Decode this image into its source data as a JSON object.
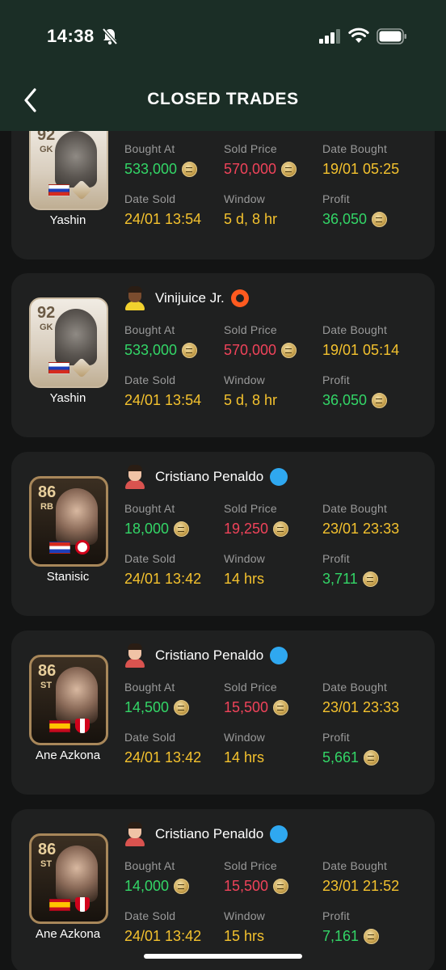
{
  "status_bar": {
    "time": "14:38"
  },
  "header": {
    "title": "CLOSED TRADES"
  },
  "labels": {
    "bought_at": "Bought At",
    "sold_price": "Sold Price",
    "date_bought": "Date Bought",
    "date_sold": "Date Sold",
    "window": "Window",
    "profit": "Profit"
  },
  "trades": [
    {
      "player": {
        "name": "Yashin",
        "rating": "92",
        "position": "GK",
        "flag": "russia"
      },
      "seller": {
        "name": "",
        "platform": ""
      },
      "bought_at": "533,000",
      "sold_price": "570,000",
      "date_bought": "19/01 05:25",
      "date_sold": "24/01 13:54",
      "window": "5 d, 8 hr",
      "profit": "36,050"
    },
    {
      "player": {
        "name": "Yashin",
        "rating": "92",
        "position": "GK",
        "flag": "russia"
      },
      "seller": {
        "name": "Vinijuice Jr.",
        "platform": "origin"
      },
      "bought_at": "533,000",
      "sold_price": "570,000",
      "date_bought": "19/01 05:14",
      "date_sold": "24/01 13:54",
      "window": "5 d, 8 hr",
      "profit": "36,050"
    },
    {
      "player": {
        "name": "Stanisic",
        "rating": "86",
        "position": "RB",
        "flag": "croatia"
      },
      "seller": {
        "name": "Cristiano Penaldo",
        "platform": "playstation"
      },
      "bought_at": "18,000",
      "sold_price": "19,250",
      "date_bought": "23/01 23:33",
      "date_sold": "24/01 13:42",
      "window": "14 hrs",
      "profit": "3,711"
    },
    {
      "player": {
        "name": "Ane Azkona",
        "rating": "86",
        "position": "ST",
        "flag": "spain"
      },
      "seller": {
        "name": "Cristiano Penaldo",
        "platform": "playstation"
      },
      "bought_at": "14,500",
      "sold_price": "15,500",
      "date_bought": "23/01 23:33",
      "date_sold": "24/01 13:42",
      "window": "14 hrs",
      "profit": "5,661"
    },
    {
      "player": {
        "name": "Ane Azkona",
        "rating": "86",
        "position": "ST",
        "flag": "spain"
      },
      "seller": {
        "name": "Cristiano Penaldo",
        "platform": "playstation"
      },
      "bought_at": "14,000",
      "sold_price": "15,500",
      "date_bought": "23/01 21:52",
      "date_sold": "24/01 13:42",
      "window": "15 hrs",
      "profit": "7,161"
    }
  ],
  "colors": {
    "header_bg": "#1b2e26",
    "card_bg": "#1f2020",
    "green": "#33d667",
    "red": "#f0435a",
    "yellow": "#f4c22e",
    "label": "#9a9a9a"
  }
}
